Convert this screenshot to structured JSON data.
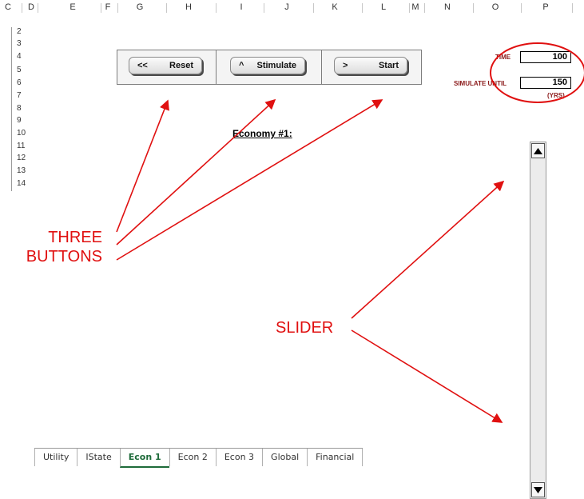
{
  "columns": [
    "C",
    "D",
    "E",
    "F",
    "G",
    "H",
    "I",
    "J",
    "K",
    "L",
    "M",
    "N",
    "O",
    "P"
  ],
  "rows": [
    "2",
    "3",
    "4",
    "5",
    "6",
    "7",
    "8",
    "9",
    "10",
    "11",
    "12",
    "13",
    "14"
  ],
  "buttons": {
    "reset": {
      "symbol": "<<",
      "label": "Reset"
    },
    "stimulate": {
      "symbol": "^",
      "label": "Stimulate"
    },
    "start": {
      "symbol": ">",
      "label": "Start"
    }
  },
  "fields": {
    "time_label": "TIME",
    "time_value": "100",
    "simulate_until_label": "SIMULATE UNTIL",
    "simulate_until_value": "150",
    "units": "(YRS)"
  },
  "title": "Economy #1:",
  "annotations": {
    "three_buttons": "THREE BUTTONS",
    "slider": "SLIDER"
  },
  "sheet_tabs": [
    {
      "label": "Utility"
    },
    {
      "label": "IState"
    },
    {
      "label": "Econ 1",
      "active": true
    },
    {
      "label": "Econ 2"
    },
    {
      "label": "Econ 3"
    },
    {
      "label": "Global"
    },
    {
      "label": "Financial"
    }
  ],
  "colors": {
    "annotation": "#e01010",
    "label": "#8b1a1a",
    "active_tab": "#1e6b3a"
  }
}
